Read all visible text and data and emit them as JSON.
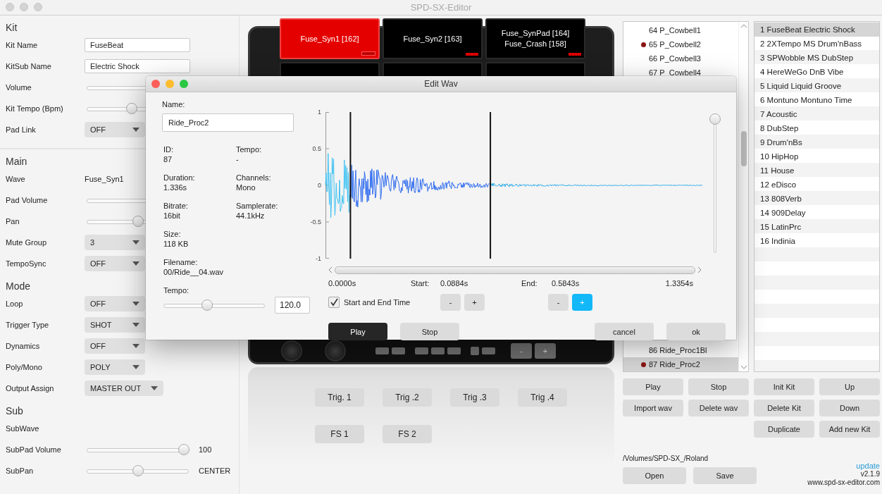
{
  "window": {
    "title": "SPD-SX-Editor"
  },
  "kit_panel": {
    "sections": [
      {
        "heading": "Kit",
        "rows": [
          {
            "label": "Kit Name",
            "kind": "field",
            "value": "FuseBeat"
          },
          {
            "label": "KitSub Name",
            "kind": "field",
            "value": "Electric Shock"
          },
          {
            "label": "Volume",
            "kind": "slider"
          },
          {
            "label": "Kit Tempo (Bpm)",
            "kind": "slider",
            "level": 0.43
          },
          {
            "label": "Pad Link",
            "kind": "dropdown",
            "value": "OFF"
          }
        ]
      },
      {
        "heading": "Main",
        "rows": [
          {
            "label": "Wave",
            "kind": "text",
            "value": "Fuse_Syn1"
          },
          {
            "label": "Pad Volume",
            "kind": "slider"
          },
          {
            "label": "Pan",
            "kind": "slider",
            "level": 0.5
          },
          {
            "label": "Mute Group",
            "kind": "dropdown",
            "value": "3"
          },
          {
            "label": "TempoSync",
            "kind": "dropdown",
            "value": "OFF"
          }
        ]
      },
      {
        "heading": "Mode",
        "rows": [
          {
            "label": "Loop",
            "kind": "dropdown",
            "value": "OFF"
          },
          {
            "label": "Trigger Type",
            "kind": "dropdown",
            "value": "SHOT"
          },
          {
            "label": "Dynamics",
            "kind": "dropdown",
            "value": "OFF"
          },
          {
            "label": "Poly/Mono",
            "kind": "dropdown",
            "value": "POLY"
          },
          {
            "label": "Output Assign",
            "kind": "dropdown",
            "value": "MASTER OUT"
          }
        ]
      },
      {
        "heading": "Sub",
        "rows": [
          {
            "label": "SubWave",
            "kind": "text"
          },
          {
            "label": "SubPad Volume",
            "kind": "slider",
            "level": 1,
            "reading": "100"
          },
          {
            "label": "SubPan",
            "kind": "slider",
            "level": 0.5,
            "reading": "CENTER"
          }
        ]
      }
    ]
  },
  "device": {
    "pads": [
      {
        "lines": [
          "Fuse_Syn1 [162]"
        ],
        "selected": true
      },
      {
        "lines": [
          "Fuse_Syn2 [163]"
        ],
        "selected": false
      },
      {
        "lines": [
          "Fuse_SynPad [164]",
          "Fuse_Crash [158]"
        ],
        "selected": false
      }
    ],
    "control_buttons": [
      "-",
      "+"
    ],
    "trigger_buttons": [
      "Trig. 1",
      "Trig .2",
      "Trig .3",
      "Trig .4"
    ],
    "footswitch_buttons": [
      "FS 1",
      "FS 2"
    ]
  },
  "wave_list": {
    "items": [
      {
        "label": "64 P_Cowbell1",
        "marked": false,
        "selected": false
      },
      {
        "label": "65 P_Cowbell2",
        "marked": true,
        "selected": false
      },
      {
        "label": "66 P_Cowbell3",
        "marked": false,
        "selected": false
      },
      {
        "label": "67 P_Cowbell4",
        "marked": false,
        "selected": false
      }
    ],
    "items_below_dialog": [
      {
        "label": "86 Ride_Proc1Bl",
        "marked": false,
        "selected": false
      },
      {
        "label": "87 Ride_Proc2",
        "marked": true,
        "selected": true
      }
    ]
  },
  "kit_list": {
    "items": [
      {
        "label": "1 FuseBeat Electric Shock",
        "selected": true
      },
      {
        "label": "2 2XTempo MS Drum'nBass",
        "selected": false
      },
      {
        "label": "3 SPWobble MS DubStep",
        "selected": false
      },
      {
        "label": "4 HereWeGo DnB Vibe",
        "selected": false
      },
      {
        "label": "5 Liquid Liquid Groove",
        "selected": false
      },
      {
        "label": "6 Montuno Montuno Time",
        "selected": false
      },
      {
        "label": "7 Acoustic",
        "selected": false
      },
      {
        "label": "8 DubStep",
        "selected": false
      },
      {
        "label": "9 Drum'nBs",
        "selected": false
      },
      {
        "label": "10 HipHop",
        "selected": false
      },
      {
        "label": "11 House",
        "selected": false
      },
      {
        "label": "12 eDisco",
        "selected": false
      },
      {
        "label": "13 808Verb",
        "selected": false
      },
      {
        "label": "14 909Delay",
        "selected": false
      },
      {
        "label": "15 LatinPrc",
        "selected": false
      },
      {
        "label": "16 Indinia",
        "selected": false
      }
    ]
  },
  "wave_buttons": [
    "Play",
    "Stop",
    "Import wav",
    "Delete wav"
  ],
  "kit_buttons": [
    "Init Kit",
    "Up",
    "Delete Kit",
    "Down",
    "Duplicate",
    "Add new Kit"
  ],
  "footer": {
    "path": "/Volumes/SPD-SX_/Roland",
    "file_buttons": [
      "Open",
      "Save"
    ],
    "update_link": "update",
    "version": "v2.1.9",
    "website": "www.spd-sx-editor.com"
  },
  "edit_wav_dialog": {
    "title": "Edit Wav",
    "name_label": "Name:",
    "name": "Ride_Proc2",
    "info": [
      {
        "label": "ID:",
        "value": "87"
      },
      {
        "label": "Tempo:",
        "value": "-"
      },
      {
        "label": "Duration:",
        "value": "1.336s"
      },
      {
        "label": "Channels:",
        "value": "Mono"
      },
      {
        "label": "Bitrate:",
        "value": "16bit"
      },
      {
        "label": "Samplerate:",
        "value": "44.1kHz"
      },
      {
        "label": "Size:",
        "value": "118 KB"
      }
    ],
    "filename": {
      "label": "Filename:",
      "value": "00/Ride__04.wav"
    },
    "tempo": {
      "label": "Tempo:",
      "level": 0.42,
      "value": "120.0"
    },
    "waveform": {
      "y_ticks": [
        "1",
        "0.5",
        "0",
        "-0.5",
        "-1"
      ]
    },
    "zoom_slider": {
      "level": 1
    },
    "time_start": "0.0000s",
    "time_end": "1.3354s",
    "start": {
      "label": "Start:",
      "value": "0.0884s"
    },
    "end": {
      "label": "End:",
      "value": "0.5843s"
    },
    "start_end_time": {
      "label": "Start and End Time",
      "checked": true
    },
    "start_buttons": [
      {
        "label": "-",
        "kind": "normal"
      },
      {
        "label": "+",
        "kind": "normal"
      }
    ],
    "end_buttons": [
      {
        "label": "-",
        "kind": "normal"
      },
      {
        "label": "+",
        "kind": "highlighted"
      }
    ],
    "buttons": [
      {
        "label": "Play",
        "kind": "default"
      },
      {
        "label": "Stop",
        "kind": "normal"
      },
      {
        "label": "cancel",
        "kind": "normal"
      },
      {
        "label": "ok",
        "kind": "normal"
      }
    ]
  }
}
